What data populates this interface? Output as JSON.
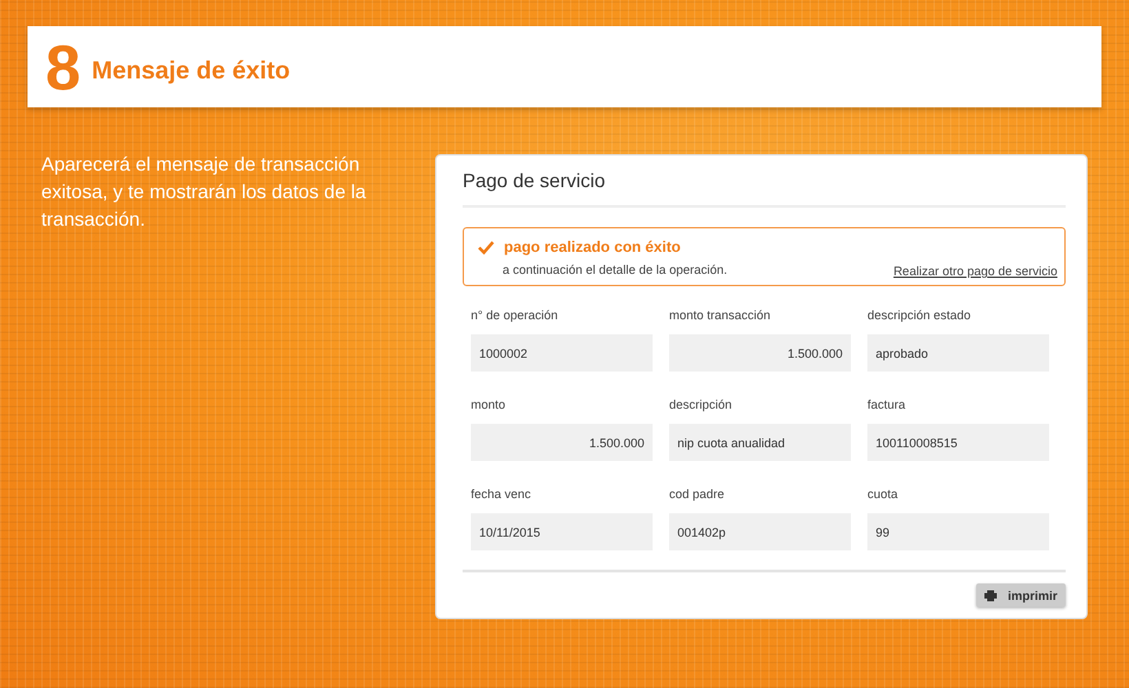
{
  "header": {
    "step": "8",
    "title": "Mensaje de éxito"
  },
  "intro": "Aparecerá el mensaje de transacción exitosa, y te mostrarán los datos de la transacción.",
  "panel": {
    "title": "Pago de servicio",
    "alert": {
      "title": "pago realizado con éxito",
      "text": "a continuación el detalle de la operación.",
      "link": "Realizar otro pago de servicio"
    },
    "fields": [
      {
        "label": "n° de operación",
        "value": "1000002",
        "kind": "text"
      },
      {
        "label": "monto transacción",
        "value": "1.500.000",
        "kind": "amount"
      },
      {
        "label": "descripción estado",
        "value": "aprobado",
        "kind": "text"
      },
      {
        "label": "monto",
        "value": "1.500.000",
        "kind": "amount"
      },
      {
        "label": "descripción",
        "value": "nip cuota anualidad",
        "kind": "text"
      },
      {
        "label": "factura",
        "value": "100110008515",
        "kind": "text"
      },
      {
        "label": "fecha venc",
        "value": "10/11/2015",
        "kind": "text"
      },
      {
        "label": "cod padre",
        "value": "001402p",
        "kind": "text"
      },
      {
        "label": "cuota",
        "value": "99",
        "kind": "text"
      }
    ],
    "print_button": "imprimir"
  }
}
